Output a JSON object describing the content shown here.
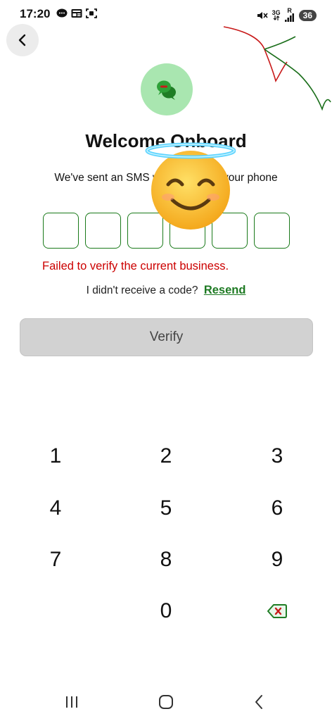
{
  "status_bar": {
    "time": "17:20",
    "network": "3G",
    "network_sub": "R",
    "battery": "36",
    "icons_left": [
      "chat-bubble-icon",
      "news-icon",
      "screenshot-icon"
    ],
    "icons_right": [
      "mute-icon",
      "data-arrows-icon",
      "signal-icon"
    ]
  },
  "header": {
    "back_icon": "chevron-left-icon",
    "logo_icon": "chat-bubbles-icon"
  },
  "main": {
    "title": "Welcome Onboard",
    "subtitle_line1": "We've sent an SMS with a code to your phone",
    "subtitle_line2": "+254",
    "otp_box_count": 6,
    "error": "Failed to verify the current business.",
    "resend_prompt": "I didn't receive a code?",
    "resend_link": "Resend",
    "verify_label": "Verify"
  },
  "keypad": {
    "keys": [
      "1",
      "2",
      "3",
      "4",
      "5",
      "6",
      "7",
      "8",
      "9",
      "",
      "0",
      "backspace-icon"
    ]
  },
  "nav_bar": {
    "items": [
      "recent-apps-icon",
      "home-icon",
      "back-icon"
    ]
  },
  "colors": {
    "accent_green": "#1e7a23",
    "error_red": "#cc0000",
    "logo_bg": "#a9e6b0",
    "button_disabled": "#d2d2d2"
  }
}
